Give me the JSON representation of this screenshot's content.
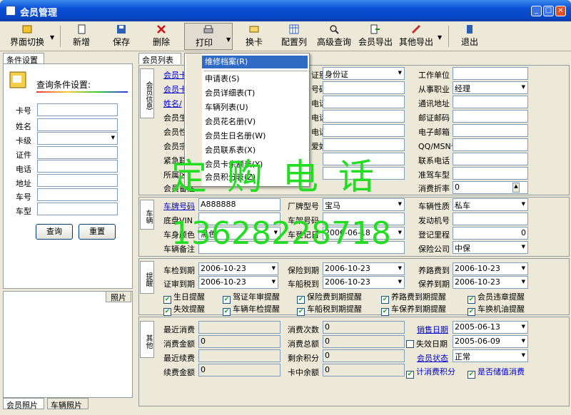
{
  "window": {
    "title": "会员管理",
    "min": "_",
    "max": "□",
    "close": "×"
  },
  "toolbar": {
    "switch": "界面切换",
    "new": "新增",
    "save": "保存",
    "delete": "删除",
    "print": "打印",
    "swipe": "换卡",
    "config": "配置列",
    "advsearch": "高级查询",
    "export": "会员导出",
    "otherexport": "其他导出",
    "exit": "退出"
  },
  "left": {
    "tab": "条件设置",
    "heading": "查询条件设置:",
    "labels": [
      "卡号",
      "姓名",
      "卡级",
      "证件",
      "电话",
      "地址",
      "车号",
      "车型"
    ],
    "query": "查询",
    "reset": "重置",
    "photo_label": "照片",
    "bottom_tabs": [
      "会员照片",
      "车辆照片"
    ]
  },
  "main_tab": "会员列表",
  "menu": {
    "items": [
      "维修档案(R)",
      "申请表(S)",
      "会员详细表(T)",
      "车辆列表(U)",
      "会员花名册(V)",
      "会员生日名册(W)",
      "会员联系表(X)",
      "会员卡余额表(Y)",
      "会员积分表(Z)"
    ]
  },
  "member": {
    "vtab": "会员信息",
    "col1": [
      "会员卡",
      "会员卡",
      "姓名/",
      "会员生",
      "会员性",
      "会员宗",
      "紧急联",
      "所属区",
      "会员备注"
    ],
    "col2": [
      "证别",
      "号码",
      "电话",
      "电话",
      "电话",
      "爱好",
      "",
      ""
    ],
    "id_type": "身份证",
    "col3": [
      "工作单位",
      "从事职业",
      "通讯地址",
      "邮证邮码",
      "电子邮箱",
      "QQ/MSN号",
      "联系电话",
      "准驾车型",
      "消费折率"
    ],
    "occupation": "经理",
    "discount": "0"
  },
  "vehicle": {
    "vtab": "车辆",
    "plate_label": "车牌号码",
    "plate": "A888888",
    "brand_label": "厂牌型号",
    "brand": "宝马",
    "nature_label": "车辆性质",
    "nature": "私车",
    "vin_label": "底盘VIN",
    "frame_label": "车架号码",
    "engine_label": "发动机号",
    "color_label": "车身颜色",
    "color": "黑色",
    "regdate_label": "车登记日",
    "regdate": "2006-06-18",
    "mileage_label": "登记里程",
    "mileage": "0",
    "note_label": "车辆备注",
    "insurer_label": "保险公司",
    "insurer": "中保"
  },
  "reminder": {
    "vtab": "提醒",
    "labels": [
      "车检到期",
      "保险到期",
      "养路费到",
      "证审到期",
      "车船税到",
      "保养到期"
    ],
    "dates": [
      "2006-10-23",
      "2006-10-23",
      "2006-10-23",
      "2006-10-23",
      "2006-10-23",
      "2006-10-23"
    ],
    "checks": [
      "生日提醒",
      "驾证年审提醒",
      "保险费到期提醒",
      "养路费到期提醒",
      "会员违章提醒",
      "失效提醒",
      "车辆年检提醒",
      "车船税到期提醒",
      "车保养到期提醒",
      "车换机油提醒"
    ]
  },
  "other": {
    "vtab": "其他",
    "l1": [
      "最近消费",
      "消费金额",
      "最近续费",
      "续费金额"
    ],
    "v1": [
      "",
      "0",
      "",
      "0"
    ],
    "l2": [
      "消费次数",
      "消费总额",
      "剩余积分",
      "卡中余额"
    ],
    "v2": [
      "0",
      "0",
      "0",
      "0"
    ],
    "sale_label": "销售日期",
    "sale": "2005-06-13",
    "expire_label": "失效日期",
    "expire": "2005-06-09",
    "status_label": "会员状态",
    "status": "正常",
    "points_chk": "计消费积分",
    "stored_chk": "是否储值消费"
  },
  "watermark": {
    "line1": "定购电话",
    "line2": "13628228718"
  }
}
